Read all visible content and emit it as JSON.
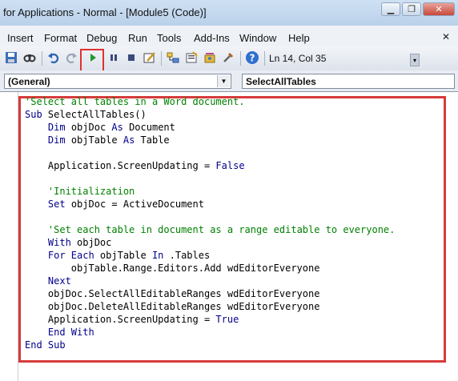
{
  "window": {
    "title": "for Applications - Normal - [Module5 (Code)]",
    "minimize_glyph": "▁",
    "restore_glyph": "❐",
    "close_glyph": "✕"
  },
  "menu": {
    "items": [
      "Insert",
      "Format",
      "Debug",
      "Run",
      "Tools",
      "Add-Ins",
      "Window",
      "Help"
    ],
    "close_glyph": "✕"
  },
  "toolbar": {
    "cursor_position": "Ln 14, Col 35",
    "icons": [
      "save-icon",
      "find-icon",
      "undo-icon",
      "redo-icon",
      "run-icon",
      "break-icon",
      "reset-icon",
      "design-mode-icon",
      "project-explorer-icon",
      "properties-icon",
      "object-browser-icon",
      "toolbox-icon",
      "help-icon"
    ],
    "run_highlight_color": "#e03030"
  },
  "combos": {
    "object": "(General)",
    "procedure": "SelectAllTables"
  },
  "colors": {
    "keyword": "#00008b",
    "comment": "#008000",
    "code_highlight": "#d73a3a"
  },
  "code": {
    "lines": [
      [
        {
          "t": "'Select all tables in a Word document.",
          "c": "cm"
        }
      ],
      [
        {
          "t": "Sub",
          "c": "kw"
        },
        {
          "t": " SelectAllTables()",
          "c": ""
        }
      ],
      [
        {
          "t": "    ",
          "c": ""
        },
        {
          "t": "Dim",
          "c": "kw"
        },
        {
          "t": " objDoc ",
          "c": ""
        },
        {
          "t": "As",
          "c": "kw"
        },
        {
          "t": " Document",
          "c": ""
        }
      ],
      [
        {
          "t": "    ",
          "c": ""
        },
        {
          "t": "Dim",
          "c": "kw"
        },
        {
          "t": " objTable ",
          "c": ""
        },
        {
          "t": "As",
          "c": "kw"
        },
        {
          "t": " Table",
          "c": ""
        }
      ],
      [
        {
          "t": "",
          "c": ""
        }
      ],
      [
        {
          "t": "    Application.ScreenUpdating = ",
          "c": ""
        },
        {
          "t": "False",
          "c": "kw"
        }
      ],
      [
        {
          "t": "",
          "c": ""
        }
      ],
      [
        {
          "t": "    ",
          "c": ""
        },
        {
          "t": "'Initialization",
          "c": "cm"
        }
      ],
      [
        {
          "t": "    ",
          "c": ""
        },
        {
          "t": "Set",
          "c": "kw"
        },
        {
          "t": " objDoc = ActiveDocument",
          "c": ""
        }
      ],
      [
        {
          "t": "",
          "c": ""
        }
      ],
      [
        {
          "t": "    ",
          "c": ""
        },
        {
          "t": "'Set each table in document as a range editable to everyone.",
          "c": "cm"
        }
      ],
      [
        {
          "t": "    ",
          "c": ""
        },
        {
          "t": "With",
          "c": "kw"
        },
        {
          "t": " objDoc",
          "c": ""
        }
      ],
      [
        {
          "t": "    ",
          "c": ""
        },
        {
          "t": "For Each",
          "c": "kw"
        },
        {
          "t": " objTable ",
          "c": ""
        },
        {
          "t": "In",
          "c": "kw"
        },
        {
          "t": " .Tables",
          "c": ""
        }
      ],
      [
        {
          "t": "        objTable.Range.Editors.Add wdEditorEveryone",
          "c": ""
        }
      ],
      [
        {
          "t": "    ",
          "c": ""
        },
        {
          "t": "Next",
          "c": "kw"
        }
      ],
      [
        {
          "t": "    objDoc.SelectAllEditableRanges wdEditorEveryone",
          "c": ""
        }
      ],
      [
        {
          "t": "    objDoc.DeleteAllEditableRanges wdEditorEveryone",
          "c": ""
        }
      ],
      [
        {
          "t": "    Application.ScreenUpdating = ",
          "c": ""
        },
        {
          "t": "True",
          "c": "kw"
        }
      ],
      [
        {
          "t": "    ",
          "c": ""
        },
        {
          "t": "End With",
          "c": "kw"
        }
      ],
      [
        {
          "t": "End Sub",
          "c": "kw"
        }
      ]
    ]
  }
}
